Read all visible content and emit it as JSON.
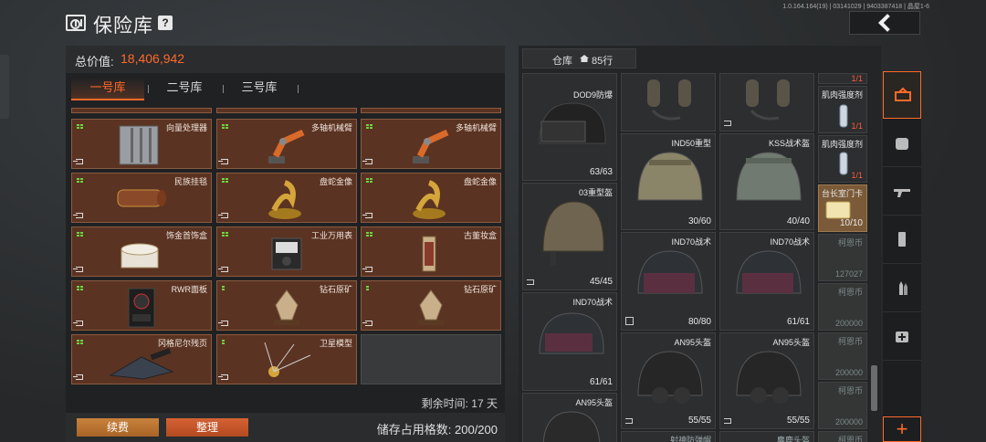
{
  "header": {
    "title": "保险库",
    "help": "?",
    "version": "1.0.164.164(19) | 03141029 | 9403387418 | 晶屋1-6"
  },
  "left": {
    "total_label": "总价值:",
    "total_value": "18,406,942",
    "tabs": [
      "一号库",
      "二号库",
      "三号库"
    ],
    "items": [
      {
        "name": "向量处理器"
      },
      {
        "name": "多轴机械臂"
      },
      {
        "name": "多轴机械臂"
      },
      {
        "name": "民族挂毯"
      },
      {
        "name": "盘蛇金像"
      },
      {
        "name": "盘蛇金像"
      },
      {
        "name": "饰金首饰盒"
      },
      {
        "name": "工业万用表"
      },
      {
        "name": "古董妆盒"
      },
      {
        "name": "RWR面板"
      },
      {
        "name": "钻石原矿"
      },
      {
        "name": "钻石原矿"
      },
      {
        "name": "冈格尼尔残页"
      },
      {
        "name": "卫星模型"
      }
    ],
    "remaining": "剩余时间:  17 天",
    "renew_btn": "续费",
    "sort_btn": "整理",
    "capacity": "储存占用格数: 200/200"
  },
  "right": {
    "warehouse_label": "仓库",
    "warehouse_count": "85行",
    "items": [
      {
        "name": "DOD9防爆",
        "dur": "63/63"
      },
      {
        "name": "IND50重型",
        "dur": "30/60"
      },
      {
        "name": "KSS战术盔",
        "dur": "40/40"
      },
      {
        "name": "03重型盔",
        "dur": "45/45"
      },
      {
        "name": "IND70战术",
        "dur": "80/80"
      },
      {
        "name": "IND70战术",
        "dur": "61/61"
      },
      {
        "name": "IND70战术",
        "dur": "61/61"
      },
      {
        "name": "AN95头盔",
        "dur": "55/55"
      },
      {
        "name": "AN95头盔",
        "dur": "55/55"
      },
      {
        "name": "AN95头盔",
        "dur": ""
      },
      {
        "name": "肌肉强度剂",
        "count": "1/1"
      },
      {
        "name": "肌肉强度剂",
        "count": "1/1"
      },
      {
        "name": "台长室门卡",
        "count": "10/10"
      }
    ],
    "top_red": "1/1",
    "faded": [
      "柯恩币",
      "127027",
      "柯恩币",
      "200000",
      "柯恩币",
      "200000",
      "柯恩币",
      "200000",
      "柯恩币"
    ],
    "bottom_partial": [
      "射神防弹帽",
      "麋鹿头盔"
    ]
  },
  "categories": [
    "tools-icon",
    "backpack-icon",
    "rifle-icon",
    "magazine-icon",
    "ammo-icon",
    "medkit-icon"
  ],
  "add_label": "+"
}
